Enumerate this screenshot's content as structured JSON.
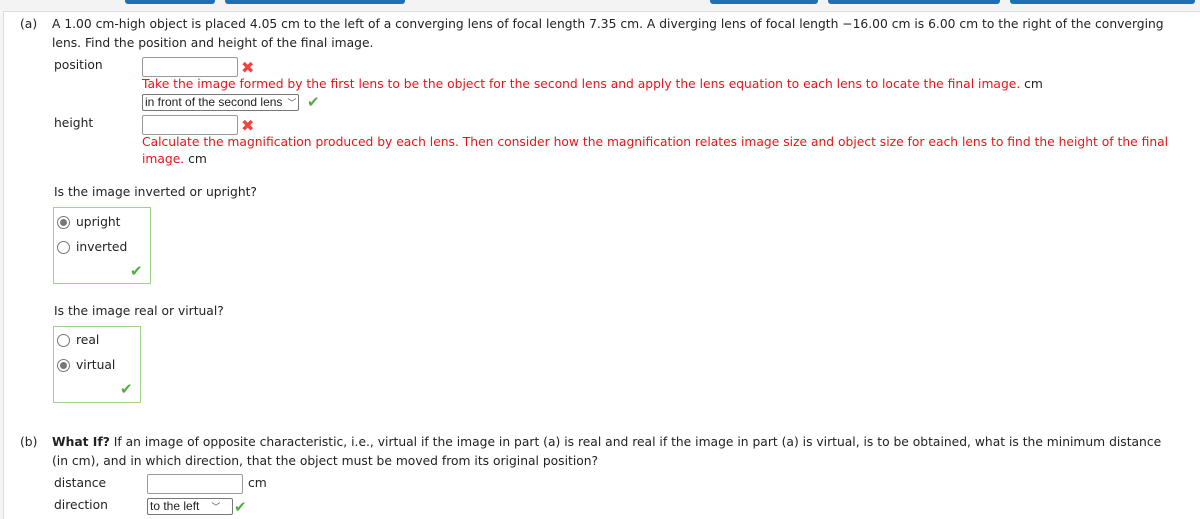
{
  "part_a": {
    "label": "(a)",
    "question_line1": "A 1.00 cm-high object is placed 4.05 cm to the left of a converging lens of focal length 7.35 cm. A diverging lens of focal length −16.00 cm is 6.00 cm to the right of the converging",
    "question_line2": "lens. Find the position and height of the final image.",
    "position": {
      "label": "position",
      "value": "",
      "hint": "Take the image formed by the first lens to be the object for the second lens and apply the lens equation to each lens to locate the final image.",
      "unit": "cm",
      "select_value": "in front of the second lens"
    },
    "height": {
      "label": "height",
      "value": "",
      "hint_line1": "Calculate the magnification produced by each lens. Then consider how the magnification relates image size and object size for each lens to find the height of the final",
      "hint_line2": "image.",
      "unit": "cm"
    },
    "orientation": {
      "question": "Is the image inverted or upright?",
      "options": [
        "upright",
        "inverted"
      ],
      "selected": "upright"
    },
    "nature": {
      "question": "Is the image real or virtual?",
      "options": [
        "real",
        "virtual"
      ],
      "selected": "virtual"
    }
  },
  "part_b": {
    "label": "(b)",
    "bold_lead": "What If?",
    "question_line1": " If an image of opposite characteristic, i.e., virtual if the image in part (a) is real and real if the image in part (a) is virtual, is to be obtained, what is the minimum distance",
    "question_line2": "(in cm), and in which direction, that the object must be moved from its original position?",
    "distance": {
      "label": "distance",
      "value": "",
      "unit": "cm"
    },
    "direction": {
      "label": "direction",
      "select_value": "to the left"
    }
  },
  "colors": {
    "error": "#e8141c",
    "correct": "#55aa44",
    "accent": "#1f6fb5"
  },
  "icons": {
    "wrong": "x-mark-icon",
    "right": "checkmark-icon",
    "dropdown": "chevron-down-icon"
  }
}
